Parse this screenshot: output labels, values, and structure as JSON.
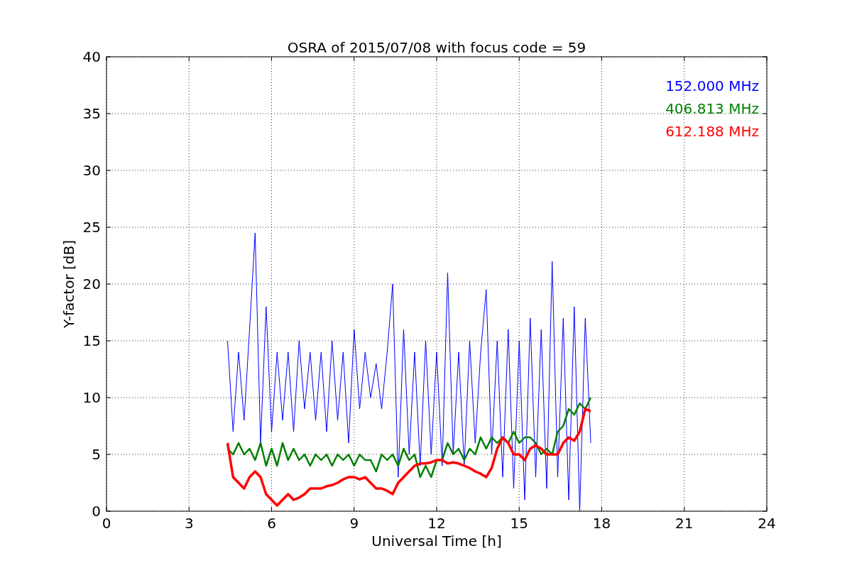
{
  "figure": {
    "chart_data": {
      "type": "line",
      "title": "OSRA of 2015/07/08 with focus code = 59",
      "xlabel": "Universal Time [h]",
      "ylabel": "Y-factor [dB]",
      "x": [
        4.4,
        4.6,
        4.8,
        5.0,
        5.2,
        5.4,
        5.6,
        5.8,
        6.0,
        6.2,
        6.4,
        6.6,
        6.8,
        7.0,
        7.2,
        7.4,
        7.6,
        7.8,
        8.0,
        8.2,
        8.4,
        8.6,
        8.8,
        9.0,
        9.2,
        9.4,
        9.6,
        9.8,
        10.0,
        10.2,
        10.4,
        10.6,
        10.8,
        11.0,
        11.2,
        11.4,
        11.6,
        11.8,
        12.0,
        12.2,
        12.4,
        12.6,
        12.8,
        13.0,
        13.2,
        13.4,
        13.6,
        13.8,
        14.0,
        14.2,
        14.4,
        14.6,
        14.8,
        15.0,
        15.2,
        15.4,
        15.6,
        15.8,
        16.0,
        16.2,
        16.4,
        16.6,
        16.8,
        17.0,
        17.2,
        17.4,
        17.6
      ],
      "series": [
        {
          "name": "152.000 MHz",
          "color": "#0000ff",
          "values": [
            15,
            7,
            14,
            8,
            16,
            24.5,
            6,
            18,
            7,
            14,
            8,
            14,
            7,
            15,
            9,
            14,
            8,
            14,
            7,
            15,
            8,
            14,
            6,
            16,
            9,
            14,
            10,
            13,
            9,
            14,
            20,
            3,
            16,
            5,
            14,
            4,
            15,
            5,
            14,
            4,
            21,
            5,
            14,
            4,
            15,
            6,
            14,
            19.5,
            5,
            15,
            3,
            16,
            2,
            15,
            1,
            17,
            3,
            16,
            2,
            22,
            3,
            17,
            1,
            18,
            0,
            17,
            6
          ]
        },
        {
          "name": "406.813 MHz",
          "color": "#008000",
          "values": [
            5.5,
            5,
            6,
            5,
            5.5,
            4.5,
            6,
            4,
            5.5,
            4,
            6,
            4.5,
            5.5,
            4.5,
            5,
            4,
            5,
            4.5,
            5,
            4,
            5,
            4.5,
            5,
            4,
            5,
            4.5,
            4.5,
            3.5,
            5,
            4.5,
            5,
            4,
            5.5,
            4.5,
            5,
            3,
            4,
            3,
            4.5,
            4.5,
            6,
            5,
            5.5,
            4.5,
            5.5,
            5,
            6.5,
            5.5,
            6.5,
            6,
            6.5,
            6,
            7,
            6,
            6.5,
            6.5,
            6,
            5,
            5.5,
            5,
            7,
            7.5,
            9,
            8.5,
            9.5,
            9,
            10
          ]
        },
        {
          "name": "612.188 MHz",
          "color": "#ff0000",
          "values": [
            6,
            3,
            2.5,
            2,
            3,
            3.5,
            3,
            1.5,
            1,
            0.5,
            1,
            1.5,
            1,
            1.2,
            1.5,
            2,
            2,
            2,
            2.2,
            2.3,
            2.5,
            2.8,
            3,
            3,
            2.8,
            3,
            2.5,
            2,
            2,
            1.8,
            1.5,
            2.5,
            3,
            3.5,
            4,
            4.2,
            4.2,
            4.3,
            4.5,
            4.5,
            4.2,
            4.3,
            4.2,
            4,
            3.8,
            3.5,
            3.3,
            3,
            3.8,
            5.5,
            6.5,
            6,
            5,
            5,
            4.5,
            5.5,
            5.8,
            5.5,
            5,
            5,
            5,
            6,
            6.5,
            6.2,
            7,
            9,
            8.8
          ]
        }
      ],
      "xlim": [
        0,
        24
      ],
      "ylim": [
        0,
        40
      ],
      "xticks": [
        0,
        3,
        6,
        9,
        12,
        15,
        18,
        21,
        24
      ],
      "yticks": [
        0,
        5,
        10,
        15,
        20,
        25,
        30,
        35,
        40
      ],
      "grid": true
    }
  }
}
